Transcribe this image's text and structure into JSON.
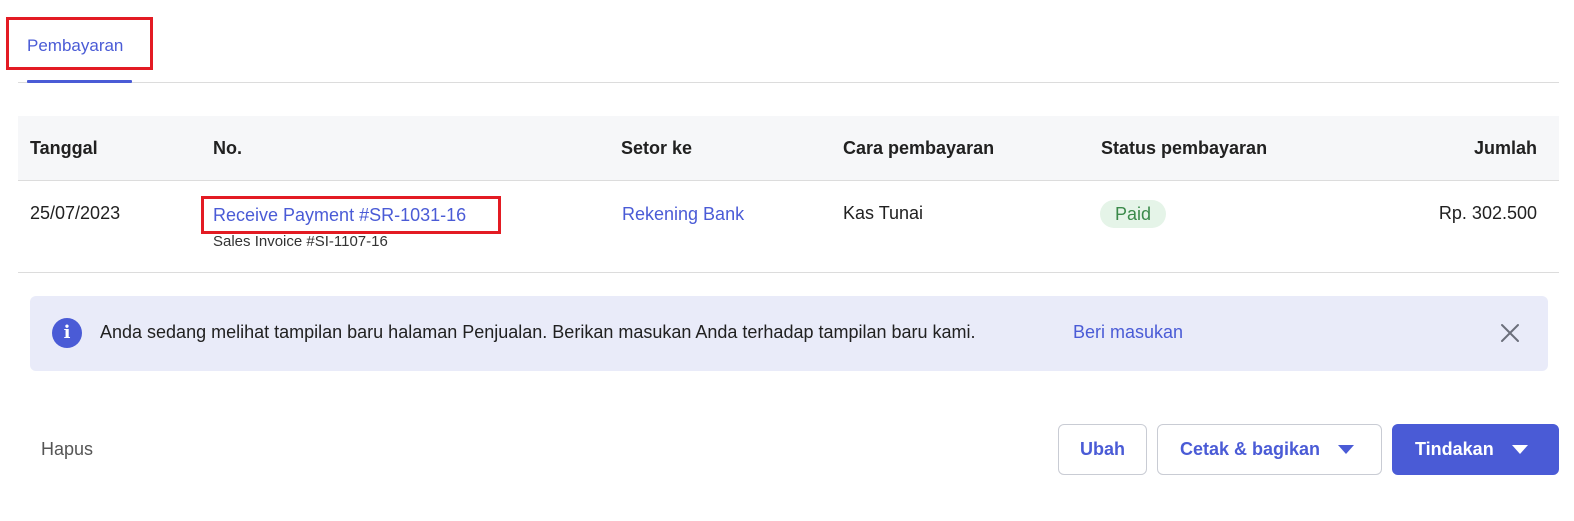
{
  "tabs": [
    {
      "label": "Pembayaran",
      "active": true
    }
  ],
  "table": {
    "columns": [
      "Tanggal",
      "No.",
      "Setor ke",
      "Cara pembayaran",
      "Status pembayaran",
      "Jumlah"
    ],
    "rows": [
      {
        "date": "25/07/2023",
        "number": "Receive Payment #SR-1031-16",
        "reference": "Sales Invoice #SI-1107-16",
        "deposit_to": "Rekening Bank",
        "payment_method": "Kas Tunai",
        "status": "Paid",
        "amount": "Rp. 302.500"
      }
    ]
  },
  "banner": {
    "icon": "info-icon",
    "message": "Anda sedang melihat tampilan baru halaman Penjualan. Berikan masukan Anda terhadap tampilan baru kami.",
    "link_label": "Beri masukan"
  },
  "actions": {
    "delete_label": "Hapus",
    "edit_label": "Ubah",
    "print_share_label": "Cetak & bagikan",
    "actions_label": "Tindakan"
  },
  "colors": {
    "accent": "#4a5bd6",
    "highlight_box": "#e31b23",
    "paid_badge_bg": "#e5f4e8",
    "paid_badge_text": "#3a8a4a",
    "banner_bg": "#e9ebf9"
  }
}
